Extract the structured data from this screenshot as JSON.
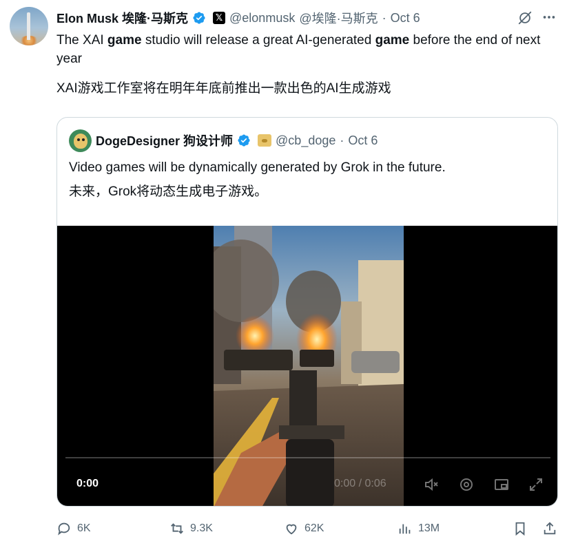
{
  "tweet": {
    "author_name": "Elon Musk 埃隆·马斯克",
    "handle": "@elonmusk",
    "handle_alt": "@埃隆·马斯克",
    "separator": "·",
    "date": "Oct 6",
    "text_parts": [
      "The XAI ",
      "game",
      " studio will release a great AI-generated ",
      "game",
      " before the end of next year"
    ],
    "text_zh": "XAI游戏工作室将在明年年底前推出一款出色的AI生成游戏"
  },
  "quoted": {
    "author_name": "DogeDesigner 狗设计师",
    "handle": "@cb_doge",
    "separator": "·",
    "date": "Oct 6",
    "text": "Video games will be dynamically generated by Grok in the future.",
    "text_zh": "未来，Grok将动态生成电子游戏。",
    "video": {
      "current_time": "0:00",
      "duration": "0:00 / 0:06",
      "progress": 0.0
    }
  },
  "actions": {
    "reply_count": "6K",
    "repost_count": "9.3K",
    "like_count": "62K",
    "views_count": "13M"
  },
  "icons": {
    "verified": "verified-badge-icon",
    "x_logo": "x-logo-icon",
    "grok": "grok-icon",
    "more": "more-icon",
    "reply": "reply-icon",
    "repost": "repost-icon",
    "like": "like-icon",
    "views": "views-icon",
    "bookmark": "bookmark-icon",
    "share": "share-icon",
    "mute": "mute-icon",
    "settings": "settings-icon",
    "pip": "picture-in-picture-icon",
    "fullscreen": "fullscreen-icon"
  },
  "colors": {
    "verified_blue": "#1d9bf0",
    "muted_text": "#536471",
    "border": "#cfd9de"
  }
}
